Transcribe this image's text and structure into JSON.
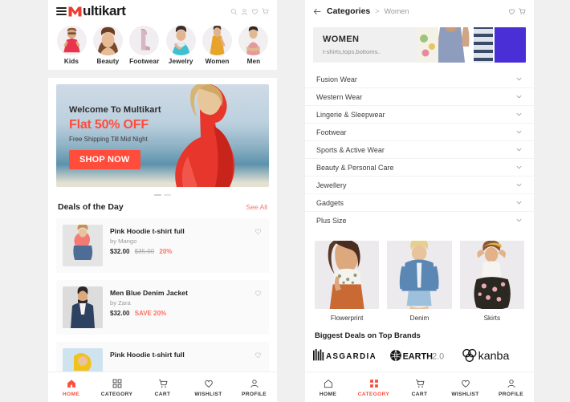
{
  "app": {
    "name": "Multikart"
  },
  "left": {
    "header": {
      "menu_icon": "hamburger-icon",
      "logo_text": "ultikart",
      "logo_mark": "crown-m-icon",
      "icons": [
        "search-icon",
        "user-icon",
        "heart-icon",
        "cart-icon"
      ]
    },
    "categories": [
      {
        "label": "Kids"
      },
      {
        "label": "Beauty"
      },
      {
        "label": "Footwear"
      },
      {
        "label": "Jewelry"
      },
      {
        "label": "Women"
      },
      {
        "label": "Men"
      }
    ],
    "banner": {
      "welcome": "Welcome To Multikart",
      "offer": "Flat 50% OFF",
      "note": "Free Shipping Till Mid Night",
      "cta": "SHOP NOW"
    },
    "deals": {
      "title": "Deals of the Day",
      "see_all": "See All",
      "items": [
        {
          "name": "Pink Hoodie t-shirt full",
          "brand": "by Mango",
          "price": "$32.00",
          "old_price": "$35.00",
          "discount": "20%",
          "save": ""
        },
        {
          "name": "Men Blue Denim Jacket",
          "brand": "by Zara",
          "price": "$32.00",
          "old_price": "",
          "discount": "",
          "save": "SAVE 20%"
        },
        {
          "name": "Pink Hoodie t-shirt full",
          "brand": "",
          "price": "",
          "old_price": "",
          "discount": "",
          "save": ""
        }
      ]
    },
    "bottom_nav": {
      "active": "HOME",
      "items": [
        {
          "label": "HOME",
          "icon": "home-icon"
        },
        {
          "label": "CATEGORY",
          "icon": "grid-icon"
        },
        {
          "label": "CART",
          "icon": "cart-icon"
        },
        {
          "label": "WISHLIST",
          "icon": "heart-icon"
        },
        {
          "label": "PROFILE",
          "icon": "user-icon"
        }
      ]
    }
  },
  "right": {
    "header": {
      "back_icon": "back-arrow-icon",
      "breadcrumb_main": "Categories",
      "breadcrumb_sep": ">",
      "breadcrumb_sub": "Women",
      "icons": [
        "heart-icon",
        "cart-icon"
      ]
    },
    "banner": {
      "title": "WOMEN",
      "subtitle": "t-shirts,tops,bottoms.."
    },
    "accordion": [
      {
        "label": "Fusion Wear"
      },
      {
        "label": "Western Wear"
      },
      {
        "label": "Lingerie & Sleepwear"
      },
      {
        "label": "Footwear"
      },
      {
        "label": "Sports & Active Wear"
      },
      {
        "label": "Beauty & Personal Care"
      },
      {
        "label": "Jewellery"
      },
      {
        "label": "Gadgets"
      },
      {
        "label": "Plus Size"
      }
    ],
    "cards": [
      {
        "label": "Flowerprint"
      },
      {
        "label": "Denim"
      },
      {
        "label": "Skirts"
      }
    ],
    "brands": {
      "title": "Biggest Deals on Top Brands",
      "items": [
        {
          "name": "ASGARDIA"
        },
        {
          "name": "EARTH2.0"
        },
        {
          "name": "kanba"
        }
      ]
    },
    "bottom_nav": {
      "active": "CATEGORY",
      "items": [
        {
          "label": "HOME",
          "icon": "home-icon"
        },
        {
          "label": "CATEGORY",
          "icon": "grid-icon"
        },
        {
          "label": "CART",
          "icon": "cart-icon"
        },
        {
          "label": "WISHLIST",
          "icon": "heart-icon"
        },
        {
          "label": "PROFILE",
          "icon": "user-icon"
        }
      ]
    }
  },
  "theme": {
    "accent": "#ff4c3b",
    "page_bg": "#f0f0f0",
    "panel_bg": "#ffffff",
    "muted": "#9b9b9b"
  }
}
